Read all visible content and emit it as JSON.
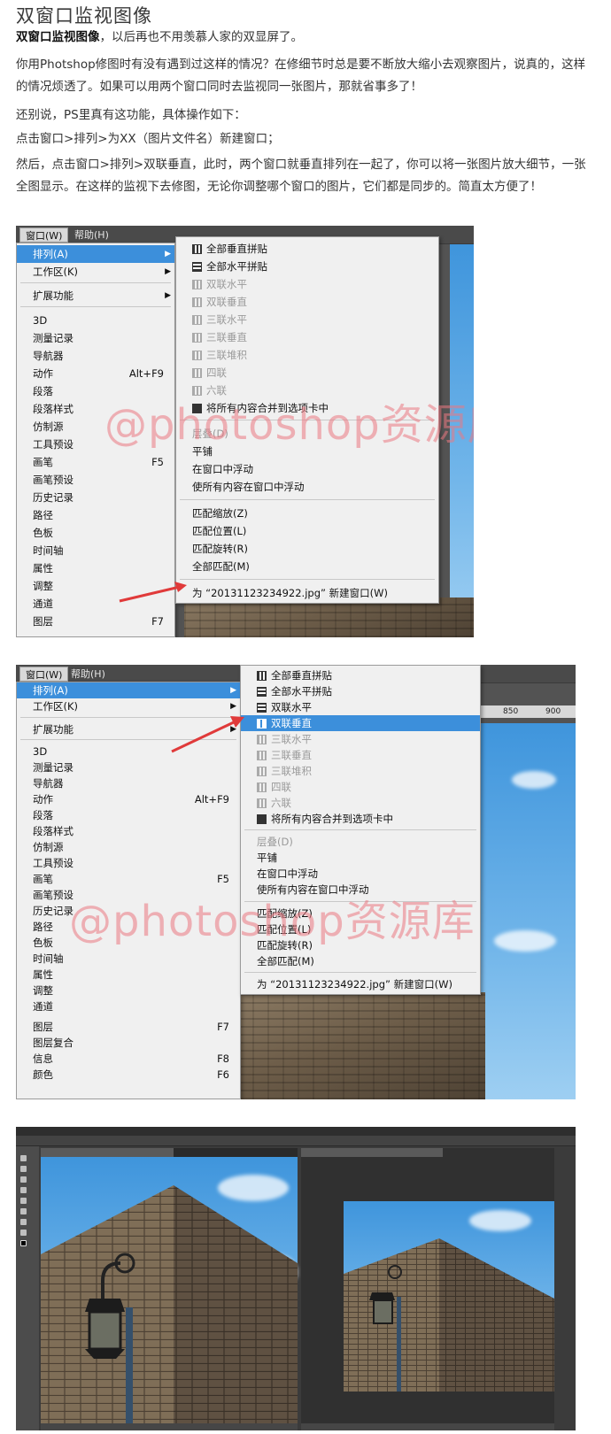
{
  "article": {
    "title": "双窗口监视图像",
    "intro_bold": "双窗口监视图像",
    "intro_rest": "，以后再也不用羡慕人家的双显屏了。",
    "para1": "你用Photshop修图时有没有遇到过这样的情况？在修细节时总是要不断放大缩小去观察图片，说真的，这样的情况烦透了。如果可以用两个窗口同时去监视同一张图片，那就省事多了！",
    "para2": "还别说，PS里真有这功能，具体操作如下：",
    "para3": "点击窗口>排列>为XX（图片文件名）新建窗口；",
    "para4": "然后，点击窗口>排列>双联垂直，此时，两个窗口就垂直排列在一起了，你可以将一张图片放大细节，一张全图显示。在这样的监视下去修图，无论你调整哪个窗口的图片，它们都是同步的。简直太方便了！"
  },
  "watermark": "@photoshop资源库",
  "menubar": {
    "window": "窗口(W)",
    "help": "帮助(H)"
  },
  "window_menu": [
    {
      "label": "排列(A)",
      "arrow": true
    },
    {
      "label": "工作区(K)",
      "arrow": true
    },
    {
      "label": "扩展功能",
      "arrow": true
    },
    {
      "label": "3D"
    },
    {
      "label": "测量记录"
    },
    {
      "label": "导航器"
    },
    {
      "label": "动作",
      "shortcut": "Alt+F9"
    },
    {
      "label": "段落"
    },
    {
      "label": "段落样式"
    },
    {
      "label": "仿制源"
    },
    {
      "label": "工具预设"
    },
    {
      "label": "画笔",
      "shortcut": "F5"
    },
    {
      "label": "画笔预设"
    },
    {
      "label": "历史记录"
    },
    {
      "label": "路径"
    },
    {
      "label": "色板"
    },
    {
      "label": "时间轴"
    },
    {
      "label": "属性"
    },
    {
      "label": "调整"
    },
    {
      "label": "通道"
    },
    {
      "label": "图层",
      "shortcut": "F7"
    },
    {
      "label": "图层复合"
    },
    {
      "label": "信息",
      "shortcut": "F8"
    },
    {
      "label": "颜色",
      "shortcut": "F6"
    }
  ],
  "arrange_menu": [
    {
      "label": "全部垂直拼贴",
      "icon": "tile-vertical-icon"
    },
    {
      "label": "全部水平拼贴",
      "icon": "tile-horizontal-icon"
    },
    {
      "label": "双联水平",
      "icon": "two-up-horizontal-icon"
    },
    {
      "label": "双联垂直",
      "icon": "two-up-vertical-icon"
    },
    {
      "label": "三联水平",
      "icon": "three-up-horizontal-icon"
    },
    {
      "label": "三联垂直",
      "icon": "three-up-vertical-icon"
    },
    {
      "label": "三联堆积",
      "icon": "three-up-stacked-icon"
    },
    {
      "label": "四联",
      "icon": "four-up-icon"
    },
    {
      "label": "六联",
      "icon": "six-up-icon"
    },
    {
      "label": "将所有内容合并到选项卡中",
      "icon": "consolidate-tabs-icon"
    },
    {
      "label": "层叠(D)"
    },
    {
      "label": "平铺"
    },
    {
      "label": "在窗口中浮动"
    },
    {
      "label": "使所有内容在窗口中浮动"
    },
    {
      "label": "匹配缩放(Z)"
    },
    {
      "label": "匹配位置(L)"
    },
    {
      "label": "匹配旋转(R)"
    },
    {
      "label": "全部匹配(M)"
    },
    {
      "label": "为 “20131123234922.jpg” 新建窗口(W)"
    }
  ],
  "ruler": {
    "label_a": "850",
    "label_b": "900"
  },
  "colors": {
    "highlight": "#3c8fdb",
    "arrow": "#e03a3a",
    "watermark": "#eb7882"
  }
}
